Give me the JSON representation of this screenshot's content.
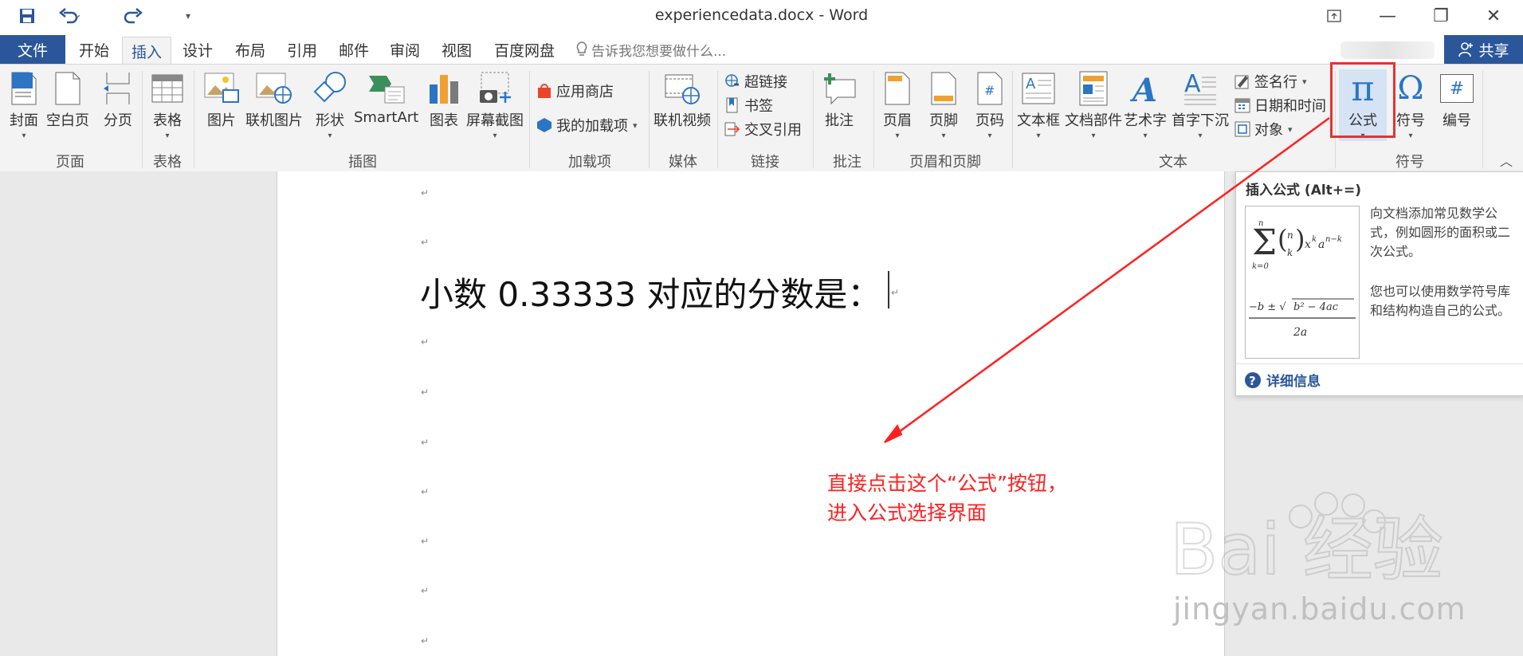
{
  "window": {
    "title": "experiencedata.docx - Word",
    "minimize": "—",
    "restore": "❐",
    "close": "✕"
  },
  "tabs": {
    "file": "文件",
    "items": [
      "开始",
      "插入",
      "设计",
      "布局",
      "引用",
      "邮件",
      "审阅",
      "视图",
      "百度网盘"
    ],
    "active": "插入",
    "tell_me": "告诉我您想要做什么...",
    "share": "共享"
  },
  "ribbon": {
    "pages": {
      "cover": "封面",
      "blank": "空白页",
      "break": "分页",
      "group": "页面"
    },
    "tables": {
      "table": "表格",
      "group": "表格"
    },
    "illustrations": {
      "picture": "图片",
      "online_picture": "联机图片",
      "shapes": "形状",
      "smartart": "SmartArt",
      "chart": "图表",
      "screenshot": "屏幕截图",
      "group": "插图"
    },
    "addins": {
      "store": "应用商店",
      "my_addins": "我的加载项",
      "group": "加载项"
    },
    "media": {
      "online_video": "联机视频",
      "group": "媒体"
    },
    "links": {
      "hyperlink": "超链接",
      "bookmark": "书签",
      "cross_ref": "交叉引用",
      "group": "链接"
    },
    "comments": {
      "comment": "批注",
      "group": "批注"
    },
    "header_footer": {
      "header": "页眉",
      "footer": "页脚",
      "page_number": "页码",
      "group": "页眉和页脚"
    },
    "text": {
      "textbox": "文本框",
      "quick_parts": "文档部件",
      "wordart": "艺术字",
      "dropcap": "首字下沉",
      "signature": "签名行",
      "datetime": "日期和时间",
      "object": "对象",
      "group": "文本"
    },
    "symbols": {
      "equation": "公式",
      "symbol": "符号",
      "number": "编号",
      "group": "符号",
      "pi": "π",
      "omega": "Ω",
      "hash": "#"
    }
  },
  "document": {
    "line": "小数  0.33333  对应的分数是：",
    "para_mark": "↵"
  },
  "tooltip": {
    "title": "插入公式 (Alt+=)",
    "desc1": "向文档添加常见数学公式，例如圆形的面积或二次公式。",
    "desc2": "您也可以使用数学符号库和结构构造自己的公式。",
    "more": "详细信息"
  },
  "annotation": {
    "line1": "直接点击这个“公式”按钮，",
    "line2": "进入公式选择界面",
    "color": "#ff2020"
  },
  "watermark": {
    "brand": "Bai  经验",
    "url": "jingyan.baidu.com"
  }
}
